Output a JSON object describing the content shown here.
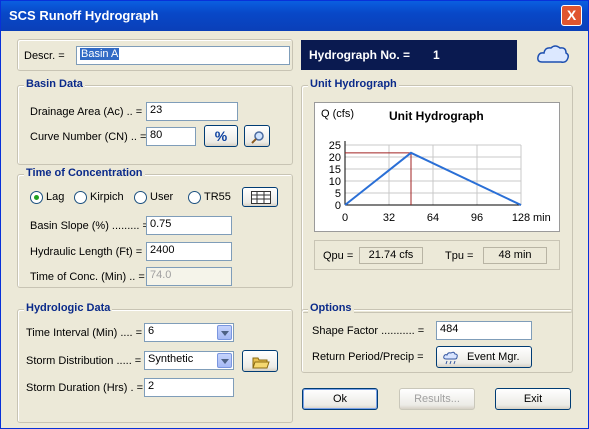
{
  "window": {
    "title": "SCS Runoff Hydrograph",
    "close_label": "X"
  },
  "descr": {
    "label": "Descr. =",
    "value": "Basin A"
  },
  "hydrograph_no": {
    "label": "Hydrograph No. =",
    "value": "1"
  },
  "basin": {
    "title": "Basin Data",
    "area_label": "Drainage Area (Ac) .. =",
    "area": "23",
    "cn_label": "Curve Number (CN) .. =",
    "cn": "80",
    "cn_button": "%"
  },
  "toc": {
    "title": "Time of Concentration",
    "methods": [
      "Lag",
      "Kirpich",
      "User",
      "TR55"
    ],
    "selected": "Lag",
    "slope_label": "Basin Slope (%) ......... =",
    "slope": "0.75",
    "length_label": "Hydraulic Length (Ft) =",
    "length": "2400",
    "tc_label": "Time of Conc. (Min) .. =",
    "tc": "74.0"
  },
  "hydrologic": {
    "title": "Hydrologic Data",
    "interval_label": "Time Interval (Min) .... =",
    "interval": "6",
    "dist_label": "Storm Distribution ..... =",
    "dist": "Synthetic",
    "duration_label": "Storm Duration (Hrs) . =",
    "duration": "2"
  },
  "unit_hydrograph": {
    "title": "Unit Hydrograph",
    "qpu_label": "Qpu =",
    "qpu": "21.74 cfs",
    "tpu_label": "Tpu =",
    "tpu": "48 min"
  },
  "chart_data": {
    "type": "line",
    "title": "Unit Hydrograph",
    "ylabel": "Q (cfs)",
    "xunit": "min",
    "xticks": [
      0,
      32,
      64,
      96,
      128
    ],
    "yticks": [
      0,
      5,
      10,
      15,
      20,
      25
    ],
    "xlim": [
      0,
      128
    ],
    "ylim": [
      0,
      25
    ],
    "series": [
      {
        "x": [
          0,
          48,
          128
        ],
        "y": [
          0,
          21.74,
          0
        ],
        "color": "#2a6fd6"
      }
    ],
    "peak_marker": {
      "x": 48,
      "y": 21.74,
      "color": "#a02020"
    }
  },
  "options": {
    "title": "Options",
    "shape_label": "Shape Factor ........... =",
    "shape": "484",
    "return_label": "Return Period/Precip =",
    "event_button": "Event Mgr."
  },
  "buttons": {
    "ok": "Ok",
    "results": "Results...",
    "exit": "Exit"
  }
}
